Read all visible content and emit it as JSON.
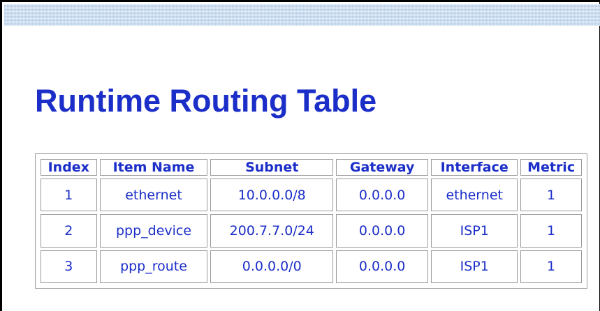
{
  "page": {
    "title": "Runtime Routing Table",
    "accent_color": "#1b2ec8",
    "top_bar_color": "#c9dcef"
  },
  "routing_table": {
    "columns": [
      "Index",
      "Item Name",
      "Subnet",
      "Gateway",
      "Interface",
      "Metric"
    ],
    "rows": [
      [
        "1",
        "ethernet",
        "10.0.0.0/8",
        "0.0.0.0",
        "ethernet",
        "1"
      ],
      [
        "2",
        "ppp_device",
        "200.7.7.0/24",
        "0.0.0.0",
        "ISP1",
        "1"
      ],
      [
        "3",
        "ppp_route",
        "0.0.0.0/0",
        "0.0.0.0",
        "ISP1",
        "1"
      ]
    ]
  }
}
